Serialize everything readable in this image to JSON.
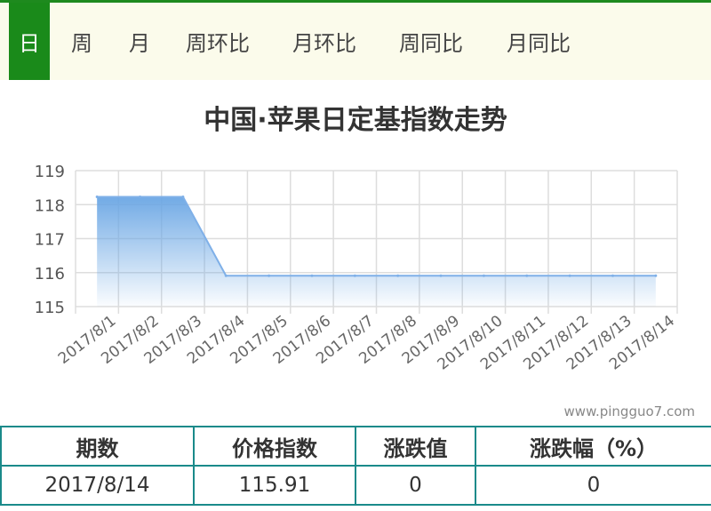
{
  "tabs": [
    {
      "label": "日",
      "active": true
    },
    {
      "label": "周",
      "active": false
    },
    {
      "label": "月",
      "active": false
    },
    {
      "label": "周环比",
      "active": false
    },
    {
      "label": "月环比",
      "active": false
    },
    {
      "label": "周同比",
      "active": false
    },
    {
      "label": "月同比",
      "active": false
    }
  ],
  "colors": {
    "accent": "#1a8a1a",
    "border": "#1a8a8a",
    "line": "#7fb0e8",
    "fill_top": "#6aa6e4"
  },
  "chart_data": {
    "type": "area",
    "title": "中国·苹果日定基指数走势",
    "categories": [
      "2017/8/1",
      "2017/8/2",
      "2017/8/3",
      "2017/8/4",
      "2017/8/5",
      "2017/8/6",
      "2017/8/7",
      "2017/8/8",
      "2017/8/9",
      "2017/8/10",
      "2017/8/11",
      "2017/8/12",
      "2017/8/13",
      "2017/8/14"
    ],
    "values": [
      118.23,
      118.23,
      118.23,
      115.91,
      115.91,
      115.91,
      115.91,
      115.91,
      115.91,
      115.91,
      115.91,
      115.91,
      115.91,
      115.91
    ],
    "ylim": [
      115,
      119
    ],
    "yticks": [
      "115",
      "116",
      "117",
      "118",
      "119"
    ],
    "grid": true,
    "legend": false
  },
  "watermark": "www.pingguo7.com",
  "table": {
    "headers": [
      "期数",
      "价格指数",
      "涨跌值",
      "涨跌幅（%）"
    ],
    "row": [
      "2017/8/14",
      "115.91",
      "0",
      "0"
    ]
  }
}
